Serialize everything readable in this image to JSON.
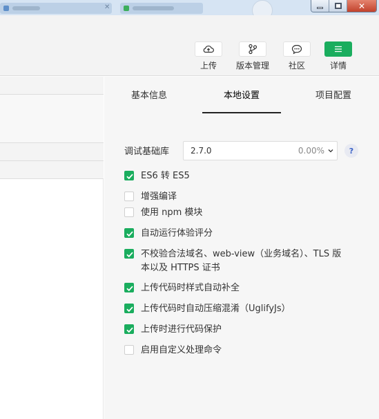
{
  "toolbar": {
    "buttons": [
      {
        "label": "上传",
        "icon": "cloud-upload-icon"
      },
      {
        "label": "版本管理",
        "icon": "branch-icon"
      },
      {
        "label": "社区",
        "icon": "chat-bubble-icon"
      },
      {
        "label": "详情",
        "icon": "menu-icon"
      }
    ]
  },
  "settings": {
    "tabs": [
      {
        "label": "基本信息",
        "active": false
      },
      {
        "label": "本地设置",
        "active": true
      },
      {
        "label": "项目配置",
        "active": false
      }
    ],
    "base_library": {
      "label": "调试基础库",
      "version": "2.7.0",
      "percent": "0.00%"
    },
    "help_icon": "?",
    "options": [
      {
        "label": "ES6 转 ES5",
        "checked": true
      },
      {
        "label": "增强编译",
        "checked": false
      },
      {
        "label": "使用 npm 模块",
        "checked": false
      },
      {
        "label": "自动运行体验评分",
        "checked": true
      },
      {
        "label": "不校验合法域名、web-view（业务域名）、TLS 版本以及 HTTPS 证书",
        "checked": true
      },
      {
        "label": "上传代码时样式自动补全",
        "checked": true
      },
      {
        "label": "上传代码时自动压缩混淆（UglifyJs）",
        "checked": true
      },
      {
        "label": "上传时进行代码保护",
        "checked": true
      },
      {
        "label": "启用自定义处理命令",
        "checked": false
      }
    ]
  },
  "colors": {
    "accent_green": "#1aad5e",
    "panel_bg": "#f6f6f6",
    "toolbar_bg": "#f3f3f3"
  }
}
